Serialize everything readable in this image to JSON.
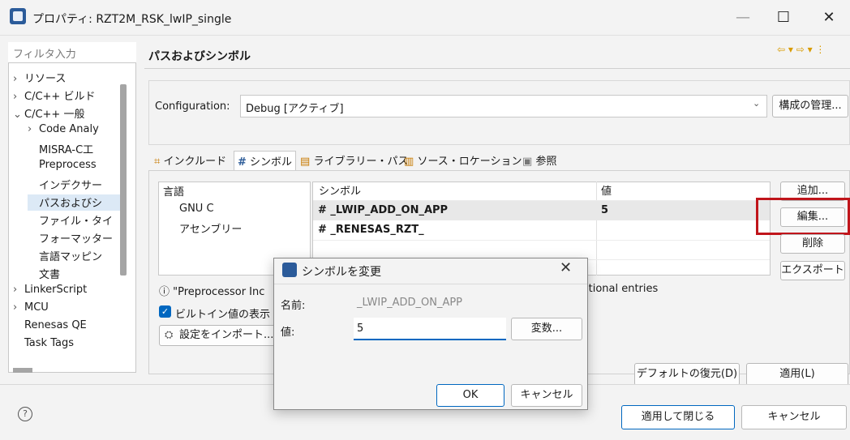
{
  "window": {
    "title": "プロパティ: RZT2M_RSK_lwIP_single",
    "minimize_icon": "—",
    "maximize_icon": "☐",
    "close_icon": "✕"
  },
  "sidebar": {
    "filter_placeholder": "フィルタ入力",
    "items": [
      {
        "label": "リソース",
        "prefix": "›"
      },
      {
        "label": "C/C++ ビルド",
        "prefix": "›"
      },
      {
        "label": "C/C++ 一般",
        "prefix": "⌄"
      },
      {
        "label": "Code Analy",
        "prefix": "›"
      },
      {
        "label": "MISRA-C工",
        "prefix": ""
      },
      {
        "label": "Preprocess",
        "prefix": ""
      },
      {
        "label": "インデクサー",
        "prefix": ""
      },
      {
        "label": "パスおよびシ",
        "prefix": ""
      },
      {
        "label": "ファイル・タイ",
        "prefix": ""
      },
      {
        "label": "フォーマッター",
        "prefix": ""
      },
      {
        "label": "言語マッピン",
        "prefix": ""
      },
      {
        "label": "文書",
        "prefix": ""
      },
      {
        "label": "LinkerScript",
        "prefix": "›"
      },
      {
        "label": "MCU",
        "prefix": "›"
      },
      {
        "label": "Renesas QE",
        "prefix": ""
      },
      {
        "label": "Task Tags",
        "prefix": ""
      }
    ]
  },
  "page": {
    "title": "パスおよびシンボル",
    "nav": "⇦ ▾ ⇨ ▾ ⋮"
  },
  "configuration": {
    "label": "Configuration:",
    "value": "Debug [アクティブ]",
    "manage_button": "構成の管理..."
  },
  "tabs": [
    {
      "icon": "⌗",
      "label": "インクルード"
    },
    {
      "icon": "#",
      "label": "シンボル"
    },
    {
      "icon": "▤",
      "label": "ライブラリー・パス"
    },
    {
      "icon": "▥",
      "label": "ソース・ロケーション"
    },
    {
      "icon": "▣",
      "label": "参照"
    }
  ],
  "languages": {
    "header": "言語",
    "items": [
      "GNU C",
      "アセンブリー"
    ]
  },
  "symbols_table": {
    "col_symbol": "シンボル",
    "col_value": "値",
    "rows": [
      {
        "symbol": "# _LWIP_ADD_ON_APP",
        "value": "5"
      },
      {
        "symbol": "# _RENESAS_RZT_",
        "value": ""
      }
    ]
  },
  "side_buttons": {
    "add": "追加...",
    "edit": "編集...",
    "delete": "削除",
    "export": "エクスポート"
  },
  "info": {
    "text_left": "ⓘ \"Preprocessor Inc",
    "text_right": "itional entries"
  },
  "checkbox": {
    "label": "ビルトイン値の表示",
    "checked_glyph": "✓"
  },
  "import_button": "設定をインポート...",
  "restore_default": "デフォルトの復元(D)",
  "apply": "適用(L)",
  "footer": {
    "help": "?",
    "apply_close": "適用して閉じる",
    "cancel": "キャンセル"
  },
  "dialog": {
    "title": "シンボルを変更",
    "close": "✕",
    "name_label": "名前:",
    "name_value": "_LWIP_ADD_ON_APP",
    "value_label": "値:",
    "value_value": "5",
    "variables_button": "変数...",
    "ok": "OK",
    "cancel": "キャンセル"
  },
  "colors": {
    "accent": "#0067c0",
    "highlight_border": "#c0151b"
  }
}
